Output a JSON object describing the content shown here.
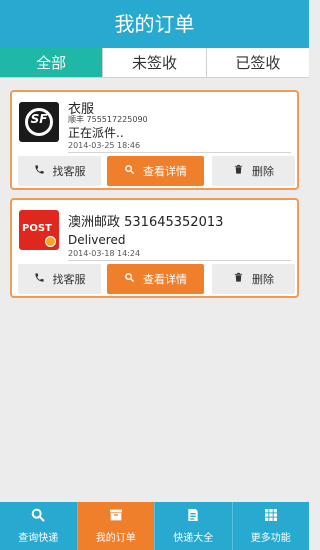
{
  "header": {
    "title": "我的订单"
  },
  "tabs": [
    {
      "label": "全部"
    },
    {
      "label": "未签收"
    },
    {
      "label": "已签收"
    }
  ],
  "orders": [
    {
      "logo_text": "SF",
      "title": "衣服",
      "sub": "顺丰 755517225090",
      "status": "正在派件..",
      "date": "2014-03-25 18:46"
    },
    {
      "logo_text": "POST",
      "title": "澳洲邮政 531645352013",
      "status": "Delivered",
      "date": "2014-03-18 14:24"
    }
  ],
  "actions": {
    "service": "找客服",
    "details": "查看详情",
    "delete": "删除"
  },
  "bottom_nav": [
    {
      "label": "查询快递",
      "icon": "search-icon"
    },
    {
      "label": "我的订单",
      "icon": "box-icon"
    },
    {
      "label": "快递大全",
      "icon": "book-icon"
    },
    {
      "label": "更多功能",
      "icon": "grid-icon"
    }
  ],
  "colors": {
    "header": "#27a9d0",
    "active_tab": "#1fb7a6",
    "accent": "#f07f2c",
    "card_border": "#f39a55"
  }
}
